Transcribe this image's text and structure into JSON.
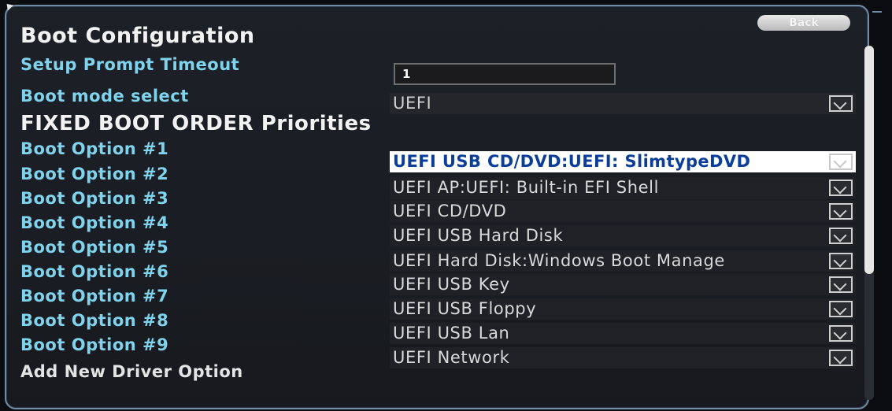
{
  "back_button": {
    "label": "Back"
  },
  "page": {
    "title": "Boot Configuration",
    "section_title": "FIXED BOOT ORDER Priorities"
  },
  "settings": {
    "setup_prompt_timeout": {
      "label": "Setup Prompt Timeout",
      "value": "1"
    },
    "boot_mode_select": {
      "label": "Boot mode select",
      "value": "UEFI"
    }
  },
  "boot_options": [
    {
      "label": "Boot Option #1",
      "value": "UEFI USB CD/DVD:UEFI: SlimtypeDVD",
      "selected": true
    },
    {
      "label": "Boot Option #2",
      "value": "UEFI AP:UEFI: Built-in EFI Shell"
    },
    {
      "label": "Boot Option #3",
      "value": "UEFI CD/DVD"
    },
    {
      "label": "Boot Option #4",
      "value": "UEFI USB Hard Disk"
    },
    {
      "label": "Boot Option #5",
      "value": "UEFI Hard Disk:Windows Boot Manage"
    },
    {
      "label": "Boot Option #6",
      "value": "UEFI USB Key"
    },
    {
      "label": "Boot Option #7",
      "value": "UEFI USB Floppy"
    },
    {
      "label": "Boot Option #8",
      "value": "UEFI USB Lan"
    },
    {
      "label": "Boot Option #9",
      "value": "UEFI Network"
    }
  ],
  "add_new_driver_option": {
    "label": "Add New Driver Option"
  },
  "icons": {
    "dropdown": "chevron-down-icon",
    "cursor": "mouse-cursor-icon"
  },
  "colors": {
    "label_cyan": "#7fd3ec",
    "selected_text": "#0b3e9a",
    "cursor_red": "#d8281c"
  }
}
